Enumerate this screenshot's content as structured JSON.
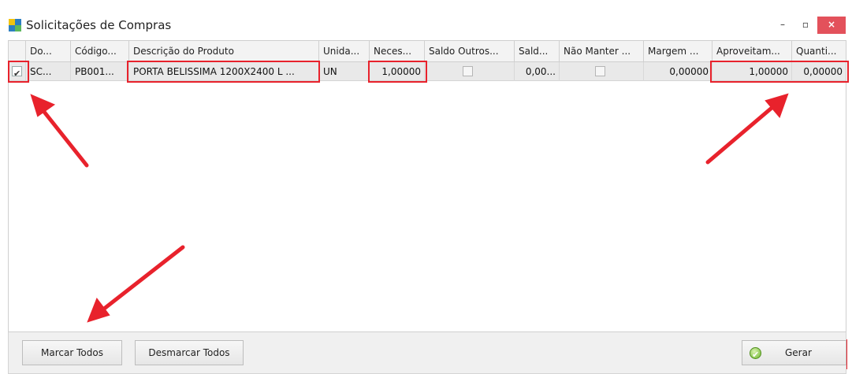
{
  "window": {
    "title": "Solicitações de Compras",
    "controls": {
      "minimize": "–",
      "maximize": "▫",
      "close": "×"
    },
    "colors": {
      "close_bg": "#e3515b",
      "highlight": "#e8222c",
      "arrow": "#e8222c"
    }
  },
  "grid": {
    "columns": [
      {
        "key": "selected",
        "label": ""
      },
      {
        "key": "doc",
        "label": "Do..."
      },
      {
        "key": "codigo",
        "label": "Código..."
      },
      {
        "key": "descricao",
        "label": "Descrição do Produto"
      },
      {
        "key": "unidade",
        "label": "Unida..."
      },
      {
        "key": "necessidade",
        "label": "Neces..."
      },
      {
        "key": "saldo_outros",
        "label": "Saldo Outros..."
      },
      {
        "key": "saldo",
        "label": "Sald..."
      },
      {
        "key": "nao_manter",
        "label": "Não Manter ..."
      },
      {
        "key": "margem",
        "label": "Margem ..."
      },
      {
        "key": "aproveitamento",
        "label": "Aproveitam..."
      },
      {
        "key": "quantidade",
        "label": "Quanti..."
      }
    ],
    "rows": [
      {
        "selected": true,
        "doc": "SC...",
        "codigo": "PB001...",
        "descricao": "PORTA BELISSIMA 1200X2400  L ...",
        "unidade": "UN",
        "necessidade": "1,00000",
        "saldo_outros": false,
        "saldo": "0,00...",
        "nao_manter": false,
        "margem": "0,00000",
        "aproveitamento": "1,00000",
        "quantidade": "0,00000"
      }
    ]
  },
  "footer": {
    "marcar_todos": "Marcar Todos",
    "desmarcar_todos": "Desmarcar Todos",
    "gerar": "Gerar"
  }
}
